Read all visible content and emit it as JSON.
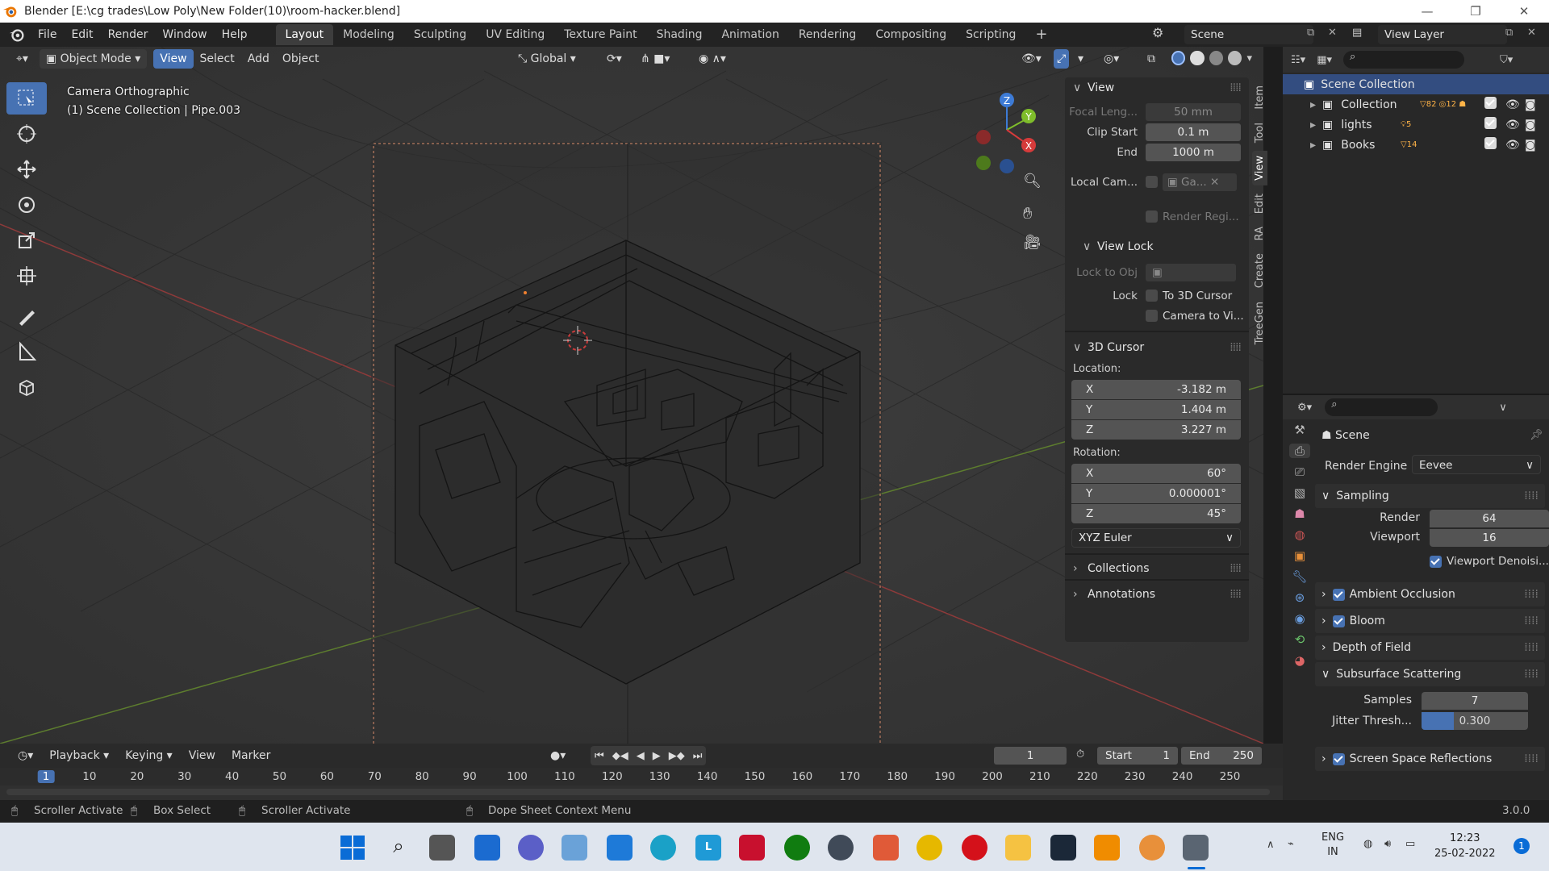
{
  "window": {
    "title": "Blender [E:\\cg trades\\Low Poly\\New Folder(10)\\room-hacker.blend]"
  },
  "menu": [
    "File",
    "Edit",
    "Render",
    "Window",
    "Help"
  ],
  "workspaces": [
    "Layout",
    "Modeling",
    "Sculpting",
    "UV Editing",
    "Texture Paint",
    "Shading",
    "Animation",
    "Rendering",
    "Compositing",
    "Scripting"
  ],
  "active_workspace": "Layout",
  "scene_name": "Scene",
  "view_layer": "View Layer",
  "viewport_header": {
    "mode": "Object Mode",
    "menus": [
      "View",
      "Select",
      "Add",
      "Object"
    ],
    "orientation": "Global"
  },
  "viewport_overlay": {
    "camera_text": "Camera Orthographic",
    "object_text": "(1) Scene Collection | Pipe.003"
  },
  "gizmo": {
    "z": "Z",
    "y": "Y",
    "x": "X"
  },
  "npanel": {
    "view_title": "View",
    "focal_label": "Focal Leng...",
    "focal_value": "50 mm",
    "clip_start_label": "Clip Start",
    "clip_start_value": "0.1 m",
    "clip_end_label": "End",
    "clip_end_value": "1000 m",
    "local_cam_label": "Local Cam...",
    "local_cam_value": "Ga...",
    "render_region_label": "Render Regi...",
    "view_lock_title": "View Lock",
    "lock_to_obj_label": "Lock to Obj",
    "lock_label": "Lock",
    "to_3d_cursor": "To 3D Cursor",
    "camera_to_view": "Camera to Vi...",
    "cursor_title": "3D Cursor",
    "location_label": "Location:",
    "loc": [
      {
        "axis": "X",
        "value": "-3.182 m"
      },
      {
        "axis": "Y",
        "value": "1.404 m"
      },
      {
        "axis": "Z",
        "value": "3.227 m"
      }
    ],
    "rotation_label": "Rotation:",
    "rot": [
      {
        "axis": "X",
        "value": "60°"
      },
      {
        "axis": "Y",
        "value": "0.000001°"
      },
      {
        "axis": "Z",
        "value": "45°"
      }
    ],
    "rot_mode": "XYZ Euler",
    "collections_title": "Collections",
    "annotations_title": "Annotations",
    "tabs": [
      "Item",
      "Tool",
      "View",
      "Edit",
      "RA",
      "Create",
      "TreeGen"
    ]
  },
  "outliner": {
    "root": "Scene Collection",
    "items": [
      {
        "name": "Collection",
        "badges": [
          "82",
          "12"
        ]
      },
      {
        "name": "lights",
        "badges": [
          "5"
        ]
      },
      {
        "name": "Books",
        "badges": [
          "14"
        ]
      }
    ]
  },
  "properties": {
    "context": "Scene",
    "render_engine_label": "Render Engine",
    "render_engine_value": "Eevee",
    "sampling_title": "Sampling",
    "render_label": "Render",
    "render_value": "64",
    "viewport_label": "Viewport",
    "viewport_value": "16",
    "denoise_label": "Viewport Denoisi...",
    "ao_label": "Ambient Occlusion",
    "bloom_label": "Bloom",
    "dof_label": "Depth of Field",
    "sss_label": "Subsurface Scattering",
    "samples_label": "Samples",
    "samples_value": "7",
    "jitter_label": "Jitter Thresh...",
    "jitter_value": "0.300",
    "jitter_fraction": 0.3,
    "ssr_label": "Screen Space Reflections"
  },
  "timeline": {
    "menus": [
      "Playback",
      "Keying",
      "View",
      "Marker"
    ],
    "current_frame": "1",
    "start_label": "Start",
    "start_value": "1",
    "end_label": "End",
    "end_value": "250",
    "ruler": [
      "1",
      "10",
      "20",
      "30",
      "40",
      "50",
      "60",
      "70",
      "80",
      "90",
      "100",
      "110",
      "120",
      "130",
      "140",
      "150",
      "160",
      "170",
      "180",
      "190",
      "200",
      "210",
      "220",
      "230",
      "240",
      "250"
    ]
  },
  "statusbar": {
    "items": [
      "Scroller Activate",
      "Box Select",
      "Scroller Activate",
      "Dope Sheet Context Menu"
    ],
    "version": "3.0.0"
  },
  "taskbar": {
    "lang1": "ENG",
    "lang2": "IN",
    "time": "12:23",
    "date": "25-02-2022",
    "notif": "1"
  },
  "colors": {
    "accent": "#4772b3",
    "axis_red": "#d63b3b",
    "axis_green": "#7fbd2b",
    "axis_blue": "#3d7bd6"
  }
}
